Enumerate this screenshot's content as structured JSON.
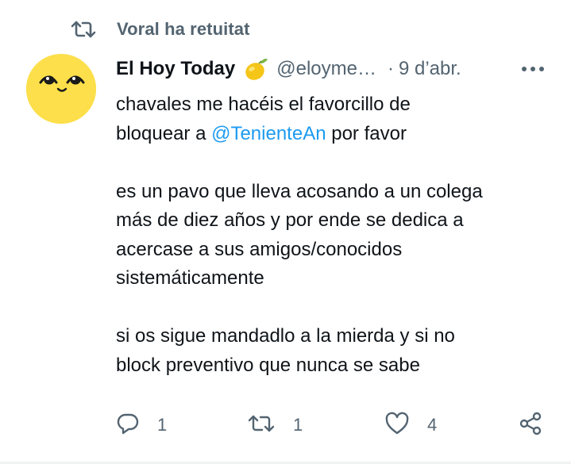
{
  "context": {
    "text": "Voral ha retuitat",
    "icon": "retweet-icon"
  },
  "author": {
    "display_name": "El Hoy Today",
    "name_emoji": "lemon-icon",
    "handle": "@eloyme…",
    "separator": "·",
    "time": "9 d’abr."
  },
  "body": {
    "line1": "chavales me hacéis el favorcillo de",
    "line2_before": "bloquear a ",
    "mention": "@TenienteAn",
    "line2_after": " por favor",
    "line3": "es un pavo que lleva acosando a un colega",
    "line4": "más de diez años y por ende se dedica a",
    "line5": "acercase a sus amigos/conocidos",
    "line6": "sistemáticamente",
    "line7": "si os sigue mandadlo a la mierda y si no",
    "line8": "block preventivo que nunca se sabe"
  },
  "actions": {
    "replies": "1",
    "retweets": "1",
    "likes": "4"
  },
  "colors": {
    "accent": "#1d9bf0",
    "secondary_text": "#536471",
    "avatar_bg": "#fcdf4a"
  }
}
